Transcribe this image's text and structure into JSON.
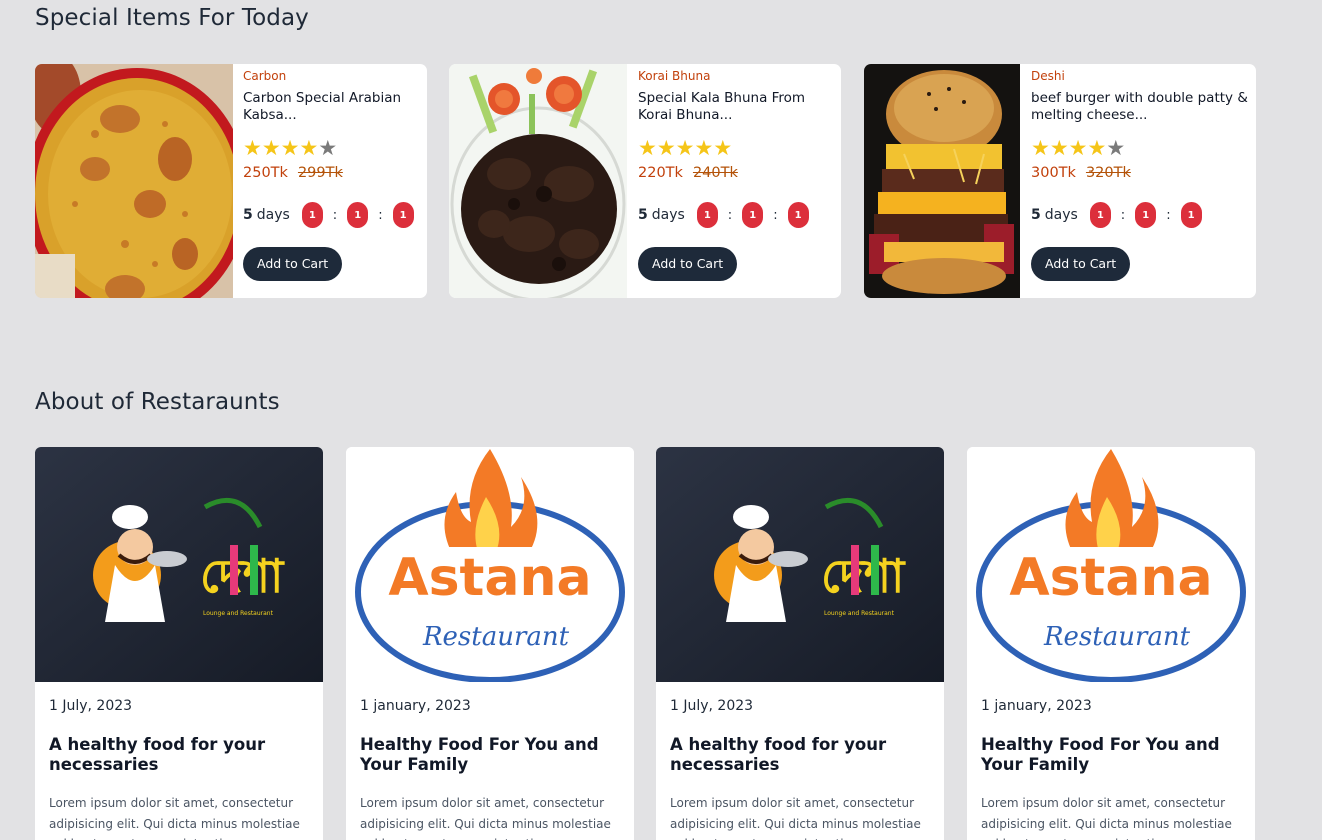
{
  "special": {
    "title": "Special Items For Today",
    "items": [
      {
        "category": "Carbon",
        "name": "Carbon Special Arabian Kabsa...",
        "rating": 4,
        "max_rating": 5,
        "price": "250Tk",
        "old_price": "299Tk",
        "days_num": "5",
        "days_label": "days",
        "h": "1",
        "m": "1",
        "s": "1",
        "sep": ":",
        "button": "Add to Cart"
      },
      {
        "category": "Korai Bhuna",
        "name": "Special Kala Bhuna From Korai Bhuna...",
        "rating": 5,
        "max_rating": 5,
        "price": "220Tk",
        "old_price": "240Tk",
        "days_num": "5",
        "days_label": "days",
        "h": "1",
        "m": "1",
        "s": "1",
        "sep": ":",
        "button": "Add to Cart"
      },
      {
        "category": "Deshi",
        "name": "beef burger with double patty & melting cheese...",
        "rating": 4,
        "max_rating": 5,
        "price": "300Tk",
        "old_price": "320Tk",
        "days_num": "5",
        "days_label": "days",
        "h": "1",
        "m": "1",
        "s": "1",
        "sep": ":",
        "button": "Add to Cart"
      }
    ]
  },
  "about": {
    "title": "About of Restaraunts",
    "cards": [
      {
        "date": "1 July, 2023",
        "heading": "A healthy food for your necessaries",
        "desc": "Lorem ipsum dolor sit amet, consectetur adipisicing elit. Qui dicta minus molestiae vel beatae natus eveniet ratione temporibus",
        "logo": "desha-logo",
        "logo_text": "দেশা",
        "logo_sub": "Lounge and Restaurant"
      },
      {
        "date": "1 january, 2023",
        "heading": "Healthy Food For You and Your Family",
        "desc": "Lorem ipsum dolor sit amet, consectetur adipisicing elit. Qui dicta minus molestiae vel beatae natus eveniet ratione temporibus",
        "logo": "astana-logo",
        "logo_text": "Astana",
        "logo_sub": "Restaurant"
      },
      {
        "date": "1 July, 2023",
        "heading": "A healthy food for your necessaries",
        "desc": "Lorem ipsum dolor sit amet, consectetur adipisicing elit. Qui dicta minus molestiae vel beatae natus eveniet ratione temporibus",
        "logo": "desha-logo",
        "logo_text": "দেশা",
        "logo_sub": "Lounge and Restaurant"
      },
      {
        "date": "1 january, 2023",
        "heading": "Healthy Food For You and Your Family",
        "desc": "Lorem ipsum dolor sit amet, consectetur adipisicing elit. Qui dicta minus molestiae vel beatae natus eveniet ratione temporibus",
        "logo": "astana-logo",
        "logo_text": "Astana",
        "logo_sub": "Restaurant"
      }
    ]
  },
  "colors": {
    "background": "#e2e2e4",
    "button": "#1e2a3a",
    "badge": "#dc2f3b",
    "category": "#c2410c",
    "star": "#f5c518"
  }
}
